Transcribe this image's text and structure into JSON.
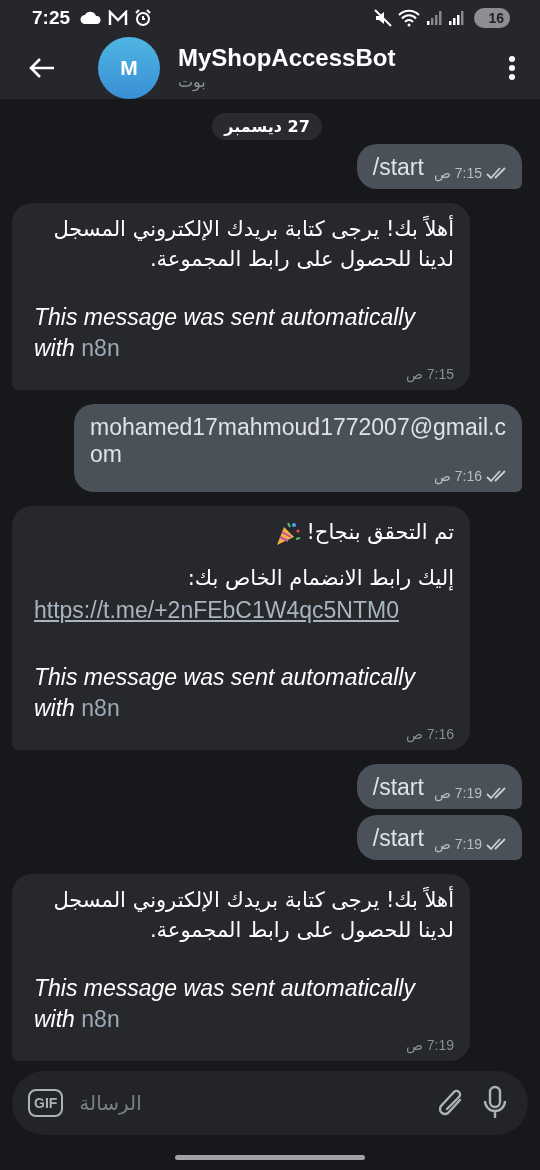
{
  "status_bar": {
    "time": "7:25",
    "battery": "16"
  },
  "header": {
    "title": "MyShopAccessBot",
    "subtitle": "بوت",
    "avatar_letter": "M"
  },
  "date_chip": "27 ديسمبر",
  "messages": [
    {
      "kind": "outgoing",
      "text": "/start",
      "time": "7:15 ص",
      "read": true
    },
    {
      "kind": "incoming",
      "time": "7:15 ص",
      "blocks": [
        {
          "kind": "text",
          "text": "أهلاً بك! يرجى كتابة بريدك الإلكتروني المسجل لدينا للحصول على رابط المجموعة."
        },
        {
          "kind": "footer",
          "text": "This message was sent automatically with",
          "link": "n8n"
        }
      ]
    },
    {
      "kind": "outgoing",
      "text": "mohamed17mahmoud1772007@gmail.com",
      "time": "7:16 ص",
      "read": true
    },
    {
      "kind": "incoming",
      "time": "7:16 ص",
      "blocks": [
        {
          "kind": "celebration",
          "text": "تم التحقق بنجاح!"
        },
        {
          "kind": "text",
          "text": "إليك رابط الانضمام الخاص بك:"
        },
        {
          "kind": "link",
          "text": "https://t.me/+2nFEbC1W4qc5NTM0"
        },
        {
          "kind": "footer",
          "text": "This message was sent automatically with",
          "link": "n8n"
        }
      ]
    },
    {
      "kind": "outgoing",
      "text": "/start",
      "time": "7:19 ص",
      "read": true
    },
    {
      "kind": "outgoing",
      "text": "/start",
      "time": "7:19 ص",
      "read": true
    },
    {
      "kind": "incoming",
      "time": "7:19 ص",
      "blocks": [
        {
          "kind": "text",
          "text": "أهلاً بك! يرجى كتابة بريدك الإلكتروني المسجل لدينا للحصول على رابط المجموعة."
        },
        {
          "kind": "footer",
          "text": "This message was sent automatically with",
          "link": "n8n"
        }
      ]
    }
  ],
  "composer": {
    "gif_label": "GIF",
    "placeholder": "الرسالة"
  }
}
